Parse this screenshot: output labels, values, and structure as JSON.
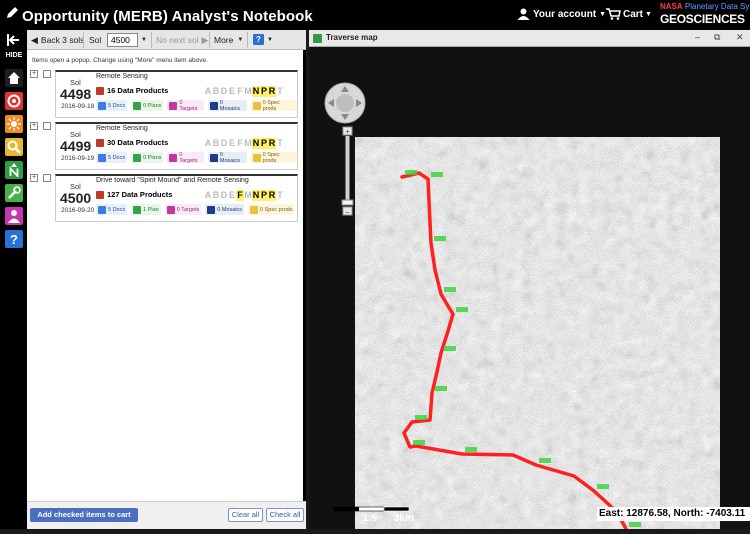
{
  "header": {
    "title": "Opportunity (MERB) Analyst's Notebook",
    "account_label": "Your account",
    "cart_label": "Cart",
    "logo": {
      "line1_brand": "NASA",
      "line1_rest": "Planetary Data System",
      "line2": "GEOSCIENCES"
    }
  },
  "leftnav": {
    "hide_label": "HIDE",
    "buttons": [
      {
        "name": "home-icon",
        "color": "#e8e8e8"
      },
      {
        "name": "target-icon",
        "color": "#e33232"
      },
      {
        "name": "sun-icon",
        "color": "#f08c1f"
      },
      {
        "name": "search-icon",
        "color": "#e6b832"
      },
      {
        "name": "north-icon",
        "color": "#2ea043"
      },
      {
        "name": "tools-icon",
        "color": "#46b04a"
      },
      {
        "name": "person-icon",
        "color": "#c437b0"
      },
      {
        "name": "help-icon",
        "color": "#2a72d6"
      }
    ]
  },
  "toolbar": {
    "back_label": "Back 3 sols",
    "sol_label": "Sol",
    "sol_value": "4500",
    "next_label": "No next sol",
    "more_label": "More",
    "help_label": "?"
  },
  "hint": "Items open a popup. Change using \"More\" menu item above.",
  "entries": [
    {
      "description": "Remote Sensing",
      "sol_label": "Sol",
      "sol": "4498",
      "date": "2016-09-18",
      "products": "16 Data Products",
      "docs": "5 Docs",
      "plans": "0 Plans",
      "targets": "0 Targets",
      "mosaics": "0 Mosaics",
      "spec": "0 Spec prods"
    },
    {
      "description": "Remote Sensing",
      "sol_label": "Sol",
      "sol": "4499",
      "date": "2016-09-19",
      "products": "30 Data Products",
      "docs": "5 Docs",
      "plans": "0 Plans",
      "targets": "0 Targets",
      "mosaics": "0 Mosaics",
      "spec": "0 Spec prods"
    },
    {
      "description": "Drive toward \"Spirit Mound\" and Remote Sensing",
      "sol_label": "Sol",
      "sol": "4500",
      "date": "2016-09-20",
      "products": "127 Data Products",
      "docs": "5 Docs",
      "plans": "1 Plan",
      "targets": "0 Targets",
      "mosaics": "0 Mosaics",
      "spec": "0 Spec prods"
    }
  ],
  "instrument_letters": [
    "A",
    "B",
    "D",
    "E",
    "F",
    "M",
    "N",
    "P",
    "R",
    "T"
  ],
  "entry_letters_on": [
    [
      "N",
      "P",
      "R"
    ],
    [
      "N",
      "P",
      "R"
    ],
    [
      "F",
      "N",
      "P",
      "R"
    ]
  ],
  "bottom": {
    "add_label": "Add checked items to cart",
    "clear_label": "Clear all",
    "check_label": "Check all"
  },
  "map": {
    "title": "Traverse map",
    "track_color": "#ff2020",
    "label_color": "#3fd43f",
    "scale_left": "1.5",
    "scale_right": "3km",
    "coord_text": "East: 12876.58, North: -7403.11"
  }
}
